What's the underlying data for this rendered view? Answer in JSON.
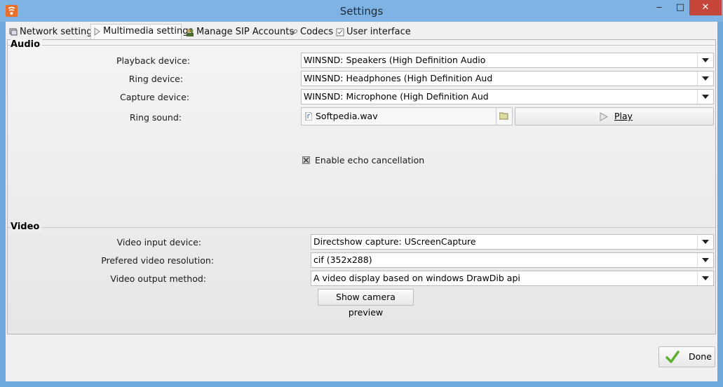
{
  "window": {
    "title": "Settings",
    "minimize": "‒",
    "maximize": "□",
    "close": "✕"
  },
  "tabs": [
    {
      "label": "Network settings",
      "icon": "network-icon"
    },
    {
      "label": "Multimedia settings",
      "icon": "play-icon"
    },
    {
      "label": "Manage SIP Accounts",
      "icon": "users-icon"
    },
    {
      "label": "Codecs",
      "icon": "link-icon"
    },
    {
      "label": "User interface",
      "icon": "checklist-icon"
    }
  ],
  "active_tab": "Multimedia settings",
  "audio": {
    "title": "Audio",
    "playback_label": "Playback device:",
    "playback_value": "WINSND: Speakers (High Definition Audio",
    "ring_label": "Ring device:",
    "ring_value": "WINSND: Headphones (High Definition Aud",
    "capture_label": "Capture device:",
    "capture_value": "WINSND: Microphone (High Definition Aud",
    "ring_sound_label": "Ring sound:",
    "ring_sound_file": "Softpedia.wav",
    "play_label": "Play",
    "echo_label": "Enable echo cancellation",
    "echo_checked": true
  },
  "video": {
    "title": "Video",
    "input_label": "Video input device:",
    "input_value": "Directshow capture: UScreenCapture",
    "resolution_label": "Prefered video resolution:",
    "resolution_value": "cif (352x288)",
    "output_label": "Video output method:",
    "output_value": "A video display based on windows DrawDib api",
    "preview_label": "Show camera preview"
  },
  "footer": {
    "done_label": "Done"
  },
  "colors": {
    "titlebar": "#7fb3e3",
    "close": "#c7463b",
    "done_check": "#5cb030"
  }
}
